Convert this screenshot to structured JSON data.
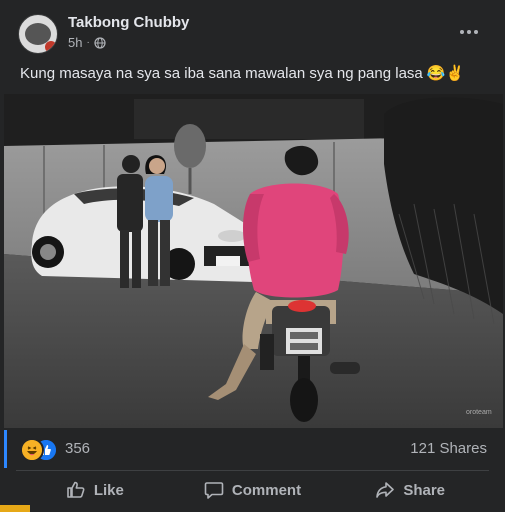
{
  "post": {
    "author": "Takbong Chubby",
    "time": "5h",
    "separator": "·",
    "caption": "Kung masaya na sya sa iba sana mawalan sya ng pang lasa 😂✌️",
    "photo_watermark": "oroteam"
  },
  "stats": {
    "reaction_count": "356",
    "shares": "121 Shares",
    "reaction_types": [
      "haha",
      "like"
    ]
  },
  "actions": {
    "like": "Like",
    "comment": "Comment",
    "share": "Share"
  },
  "colors": {
    "background": "#242526",
    "text": "#e4e6eb",
    "muted": "#b0b3b8",
    "accent": "#2d88ff",
    "like_blue": "#1877f2",
    "haha_yellow": "#f7b125",
    "shirt_pink": "#e0457b"
  },
  "icons": [
    "globe-icon",
    "more-icon",
    "haha-icon",
    "like-icon",
    "thumbs-up-icon",
    "comment-icon",
    "share-icon"
  ]
}
